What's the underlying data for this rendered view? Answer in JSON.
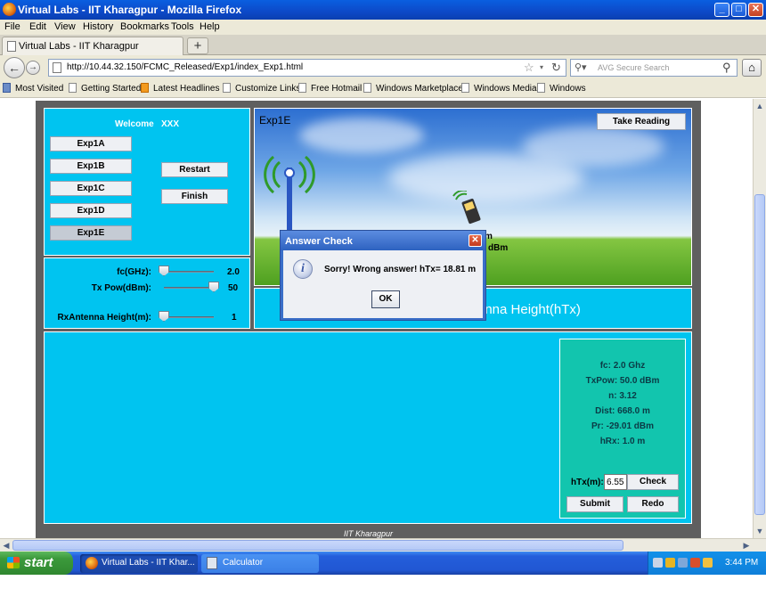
{
  "window": {
    "title": "Virtual Labs - IIT Kharagpur - Mozilla Firefox",
    "min": "_",
    "max": "□",
    "close": "✕"
  },
  "menu": [
    "File",
    "Edit",
    "View",
    "History",
    "Bookmarks",
    "Tools",
    "Help"
  ],
  "tab": {
    "label": "Virtual Labs - IIT Kharagpur",
    "new_tab": "+"
  },
  "nav": {
    "url": "http://10.44.32.150/FCMC_Released/Exp1/index_Exp1.html",
    "search_placeholder": "AVG Secure Search"
  },
  "bookmarks": [
    "Most Visited",
    "Getting Started",
    "Latest Headlines",
    "Customize Links",
    "Free Hotmail",
    "Windows Marketplace",
    "Windows Media",
    "Windows"
  ],
  "app": {
    "welcome": "Welcome   XXX",
    "exp_buttons": [
      "Exp1A",
      "Exp1B",
      "Exp1C",
      "Exp1D",
      "Exp1E"
    ],
    "restart": "Restart",
    "finish": "Finish",
    "sliders": [
      {
        "label": "fc(GHz):",
        "value": "2.0",
        "level": 0.0
      },
      {
        "label": "Tx Pow(dBm):",
        "value": "50",
        "level": 1.0
      },
      {
        "label": "RxAntenna Height(m):",
        "value": "1",
        "level": 0.0
      }
    ],
    "scene_label": "Exp1E",
    "take_reading": "Take Reading",
    "scene_text_m": "m",
    "scene_text_dbm": "dBm",
    "caption": "enna Height(hTx)",
    "results": [
      "fc: 2.0 Ghz",
      "TxPow: 50.0 dBm",
      "n: 3.12",
      "Dist: 668.0 m",
      "Pr: -29.01 dBm",
      "hRx: 1.0 m"
    ],
    "htx_label": "hTx(m):",
    "htx_value": "6.55",
    "check": "Check",
    "submit": "Submit",
    "redo": "Redo",
    "footer": "IIT Kharagpur"
  },
  "dialog": {
    "title": "Answer Check",
    "message": "Sorry!  Wrong answer! hTx= 18.81 m",
    "ok": "OK",
    "close": "✕"
  },
  "taskbar": {
    "start": "start",
    "tasks": [
      "Virtual Labs - IIT Khar...",
      "Calculator"
    ],
    "clock": "3:44 PM"
  },
  "colors": {
    "panel": "#00c4f0",
    "results": "#12c5ae",
    "titlebar": "#0c49c8"
  }
}
